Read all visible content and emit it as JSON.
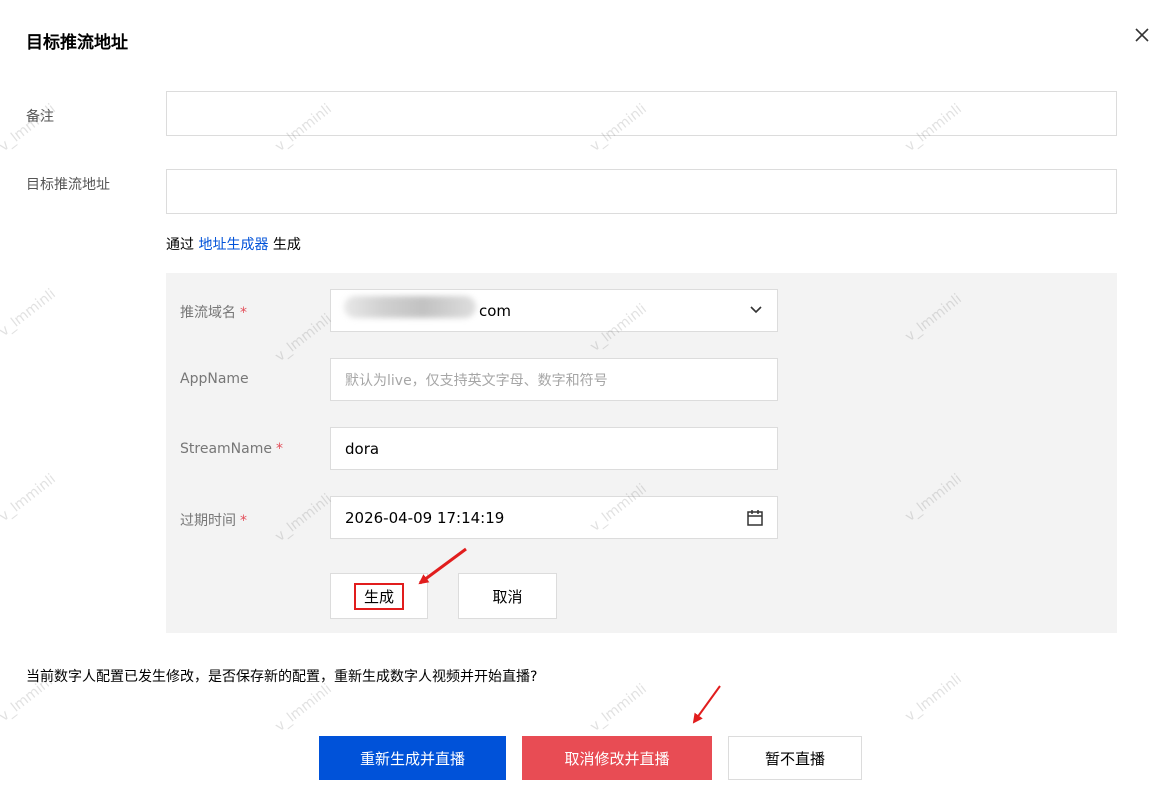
{
  "dialog": {
    "title": "目标推流地址",
    "close_icon": "close-icon"
  },
  "form": {
    "remark_label": "备注",
    "remark_value": "",
    "target_label": "目标推流地址",
    "target_value": ""
  },
  "generator": {
    "prefix": "通过",
    "link": "地址生成器",
    "suffix": "生成"
  },
  "panel": {
    "domain_label": "推流域名",
    "domain_suffix": "com",
    "appname_label": "AppName",
    "appname_placeholder": "默认为live，仅支持英文字母、数字和符号",
    "streamname_label": "StreamName",
    "streamname_value": "dora",
    "expire_label": "过期时间",
    "expire_value": "2026-04-09 17:14:19",
    "required_mark": "*",
    "generate_button": "生成",
    "cancel_button": "取消"
  },
  "notice": "当前数字人配置已发生修改，是否保存新的配置，重新生成数字人视频并开始直播?",
  "footer": {
    "regenerate_button": "重新生成并直播",
    "cancel_changes_button": "取消修改并直播",
    "not_now_button": "暂不直播"
  },
  "watermark": "v_lmminli",
  "colors": {
    "primary": "#0052d9",
    "danger": "#e84c54",
    "required": "#e34d59",
    "annotation": "#e11d1d"
  }
}
